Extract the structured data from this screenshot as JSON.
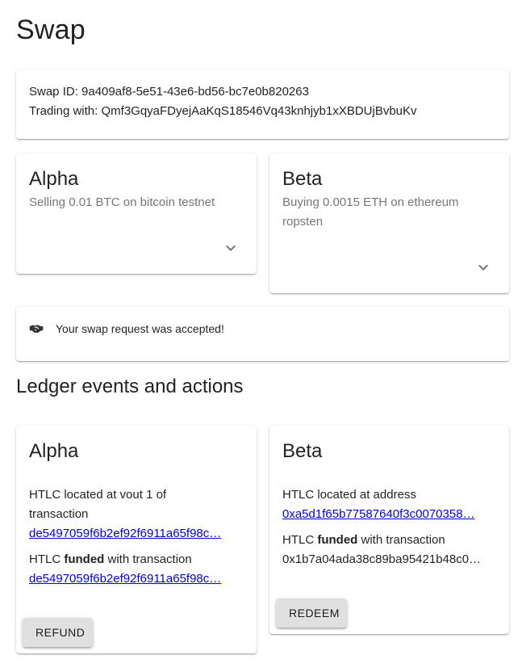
{
  "page": {
    "title": "Swap"
  },
  "info": {
    "swap_id_label": "Swap ID:",
    "swap_id": "9a409af8-5e51-43e6-bd56-bc7e0b820263",
    "trading_label": "Trading with:",
    "trading_with": "Qmf3GqyaFDyejAaKqS18546Vq43knhjyb1xXBDUjBvbuKv"
  },
  "alpha": {
    "title": "Alpha",
    "subtitle": "Selling 0.01 BTC on bitcoin testnet",
    "expand_icon": "chevron-down-icon"
  },
  "beta": {
    "title": "Beta",
    "subtitle": "Buying 0.0015 ETH on ethereum ropsten",
    "expand_icon": "chevron-down-icon"
  },
  "status": {
    "icon": "handshake-icon",
    "message": "Your swap request was accepted!"
  },
  "ledger": {
    "section_title": "Ledger events and actions",
    "alpha": {
      "title": "Alpha",
      "htlc_located_prefix": "HTLC located at vout 1 of transaction",
      "htlc_located_link": "de5497059f6b2ef92f6911a65f98c…",
      "funded_prefix": "HTLC",
      "funded_word": "funded",
      "funded_suffix": "with transaction",
      "funded_link": "de5497059f6b2ef92f6911a65f98c…",
      "button_label": "REFUND"
    },
    "beta": {
      "title": "Beta",
      "htlc_located_prefix": "HTLC located at address",
      "htlc_located_link": "0xa5d1f65b77587640f3c0070358…",
      "funded_prefix": "HTLC",
      "funded_word": "funded",
      "funded_suffix": "with transaction",
      "funded_value": "0x1b7a04ada38c89ba95421b48c0…",
      "button_label": "REDEEM"
    }
  }
}
